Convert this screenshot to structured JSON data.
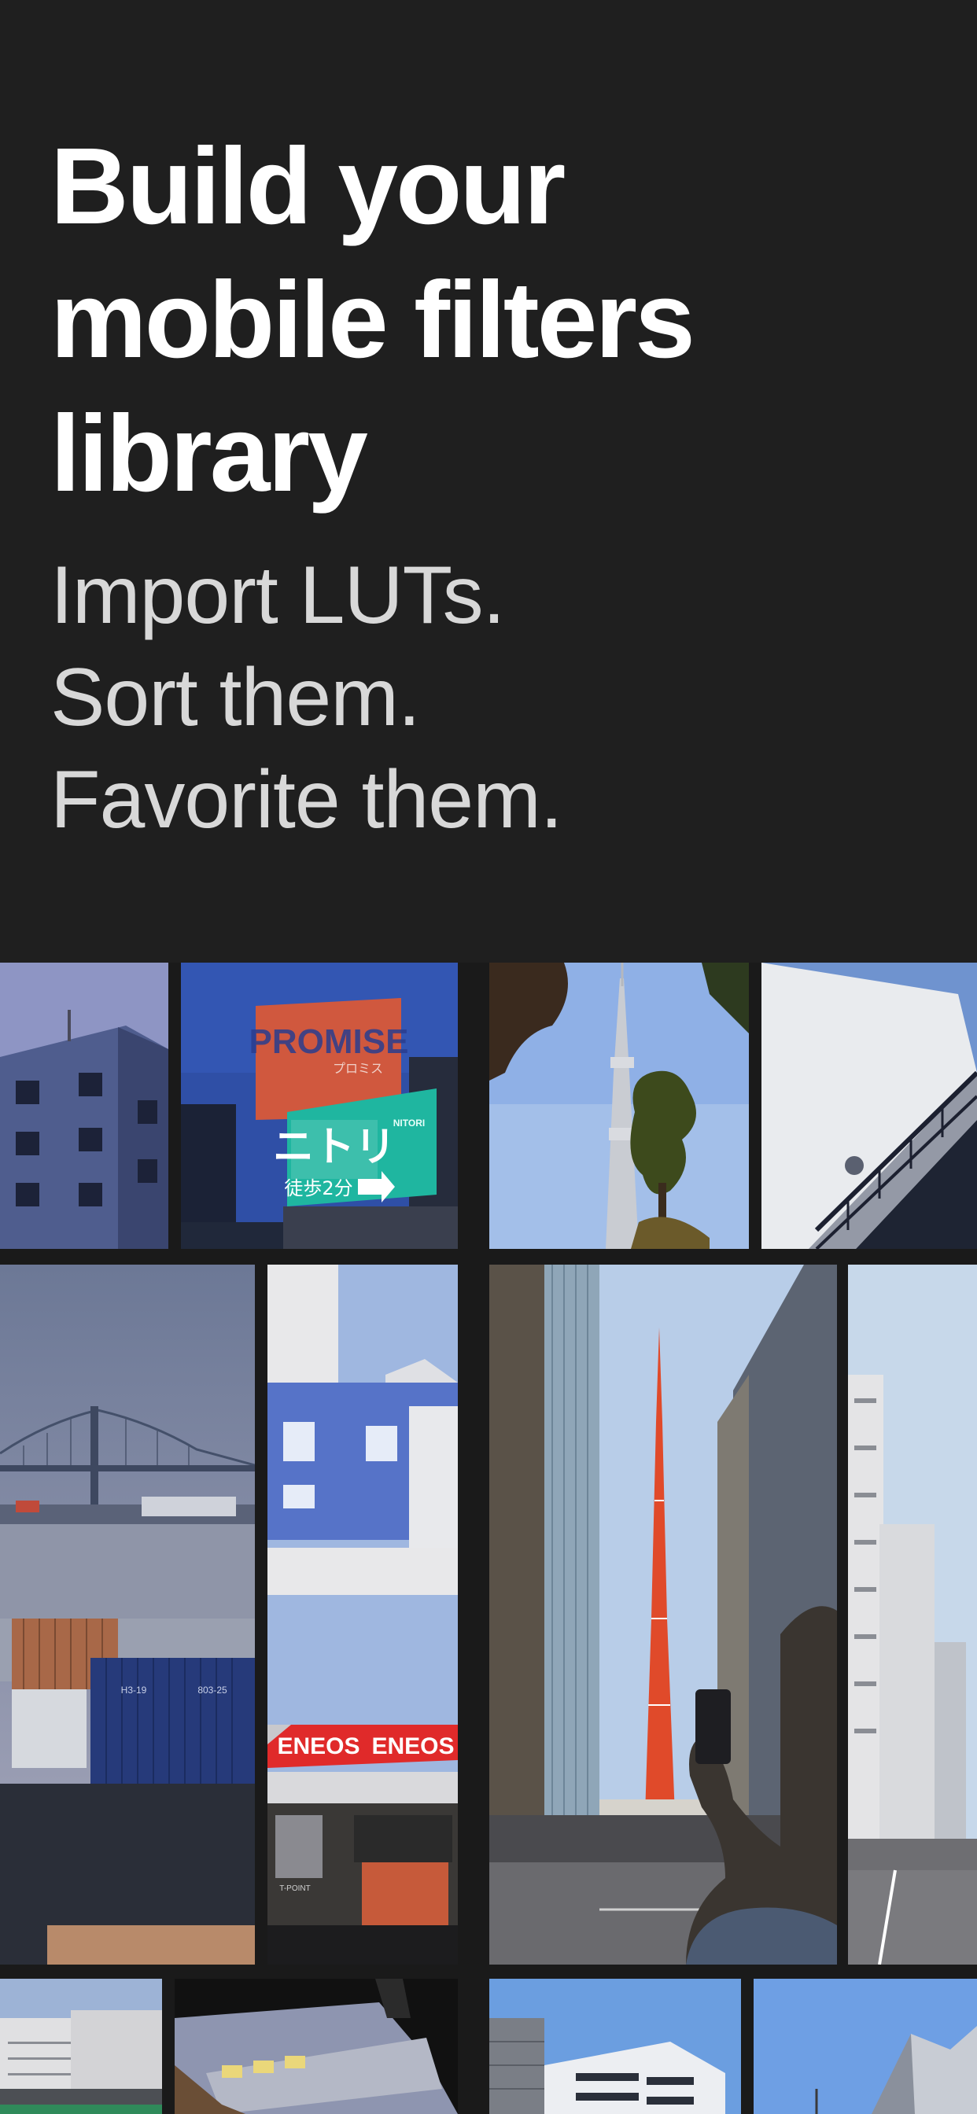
{
  "headline": {
    "line1": "Build your",
    "line2": "mobile filters",
    "line3": "library"
  },
  "tagline": {
    "line1": "Import LUTs.",
    "line2": "Sort them.",
    "line3": "Favorite them."
  },
  "colors": {
    "background": "#1f1f1f",
    "headline": "#ffffff",
    "tagline": "#d8d8d8"
  },
  "gallery": {
    "photos": [
      {
        "name": "blue-building-photo"
      },
      {
        "name": "billboard-photo",
        "billboard_top": "PROMISE",
        "billboard_top_sub": "プロミス",
        "sign_main": "ニトリ",
        "sign_side": "NITORI",
        "sign_bottom": "徒歩2分"
      },
      {
        "name": "skytree-photo"
      },
      {
        "name": "white-wall-stairs-photo"
      },
      {
        "name": "bridge-harbor-photo",
        "container_text_1": "H3-19",
        "container_text_2": "803-25"
      },
      {
        "name": "gas-station-photo",
        "sign_1": "ENEOS",
        "sign_2": "ENEOS",
        "small_sign": "T-POINT"
      },
      {
        "name": "tokyo-tower-photo"
      },
      {
        "name": "street-buildings-photo"
      },
      {
        "name": "white-buildings-rail-photo"
      },
      {
        "name": "train-photo"
      },
      {
        "name": "white-office-photo"
      },
      {
        "name": "modern-tower-photo"
      }
    ]
  }
}
